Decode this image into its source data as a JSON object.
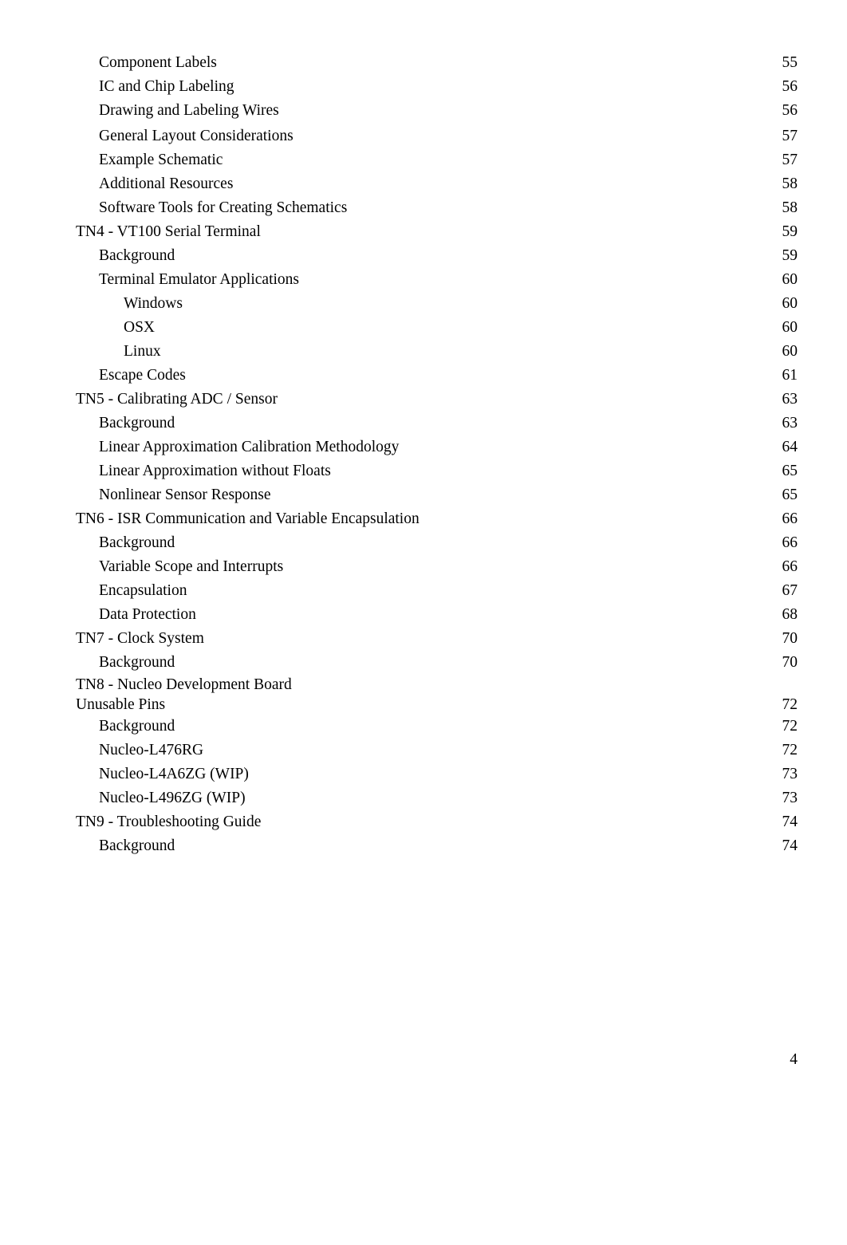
{
  "document": {
    "page_number": "4",
    "type": "table-of-contents"
  },
  "toc": {
    "entries": [
      {
        "label": "Component Labels",
        "page": "55",
        "level": 2
      },
      {
        "label": "IC and Chip Labeling",
        "page": "56",
        "level": 2
      },
      {
        "label": "Drawing and Labeling Wires",
        "page": "56",
        "level": 2
      },
      {
        "label": "General Layout Considerations",
        "page": "57",
        "level": 2
      },
      {
        "label": "Example Schematic",
        "page": "57",
        "level": 2
      },
      {
        "label": "Additional Resources",
        "page": "58",
        "level": 2
      },
      {
        "label": "Software Tools for Creating Schematics",
        "page": "58",
        "level": 2
      },
      {
        "label": "TN4 - VT100 Serial Terminal",
        "page": "59",
        "level": 1
      },
      {
        "label": "Background",
        "page": "59",
        "level": 2
      },
      {
        "label": "Terminal Emulator Applications",
        "page": "60",
        "level": 2
      },
      {
        "label": "Windows",
        "page": "60",
        "level": 3
      },
      {
        "label": "OSX",
        "page": "60",
        "level": 3
      },
      {
        "label": "Linux",
        "page": "60",
        "level": 3
      },
      {
        "label": "Escape Codes",
        "page": "61",
        "level": 2
      },
      {
        "label": "TN5 - Calibrating ADC / Sensor",
        "page": "63",
        "level": 1
      },
      {
        "label": "Background",
        "page": "63",
        "level": 2
      },
      {
        "label": "Linear Approximation Calibration Methodology",
        "page": "64",
        "level": 2
      },
      {
        "label": "Linear Approximation without Floats",
        "page": "65",
        "level": 2
      },
      {
        "label": "Nonlinear Sensor Response",
        "page": "65",
        "level": 2
      },
      {
        "label": "TN6 - ISR Communication and Variable Encapsulation",
        "page": "66",
        "level": 1
      },
      {
        "label": "Background",
        "page": "66",
        "level": 2
      },
      {
        "label": "Variable Scope and Interrupts",
        "page": "66",
        "level": 2
      },
      {
        "label": "Encapsulation",
        "page": "67",
        "level": 2
      },
      {
        "label": "Data Protection",
        "page": "68",
        "level": 2
      },
      {
        "label": "TN7 - Clock System",
        "page": "70",
        "level": 1
      },
      {
        "label": "Background",
        "page": "70",
        "level": 2
      },
      {
        "label": "TN8 - Nucleo Development Board",
        "label_line2": "Unusable Pins",
        "page": "72",
        "level": 1,
        "wrapped": true
      },
      {
        "label": "Background",
        "page": "72",
        "level": 2
      },
      {
        "label": "Nucleo-L476RG",
        "page": "72",
        "level": 2
      },
      {
        "label": "Nucleo-L4A6ZG (WIP)",
        "page": "73",
        "level": 2
      },
      {
        "label": "Nucleo-L496ZG (WIP)",
        "page": "73",
        "level": 2
      },
      {
        "label": "TN9 - Troubleshooting Guide",
        "page": "74",
        "level": 1
      },
      {
        "label": "Background",
        "page": "74",
        "level": 2
      }
    ]
  }
}
